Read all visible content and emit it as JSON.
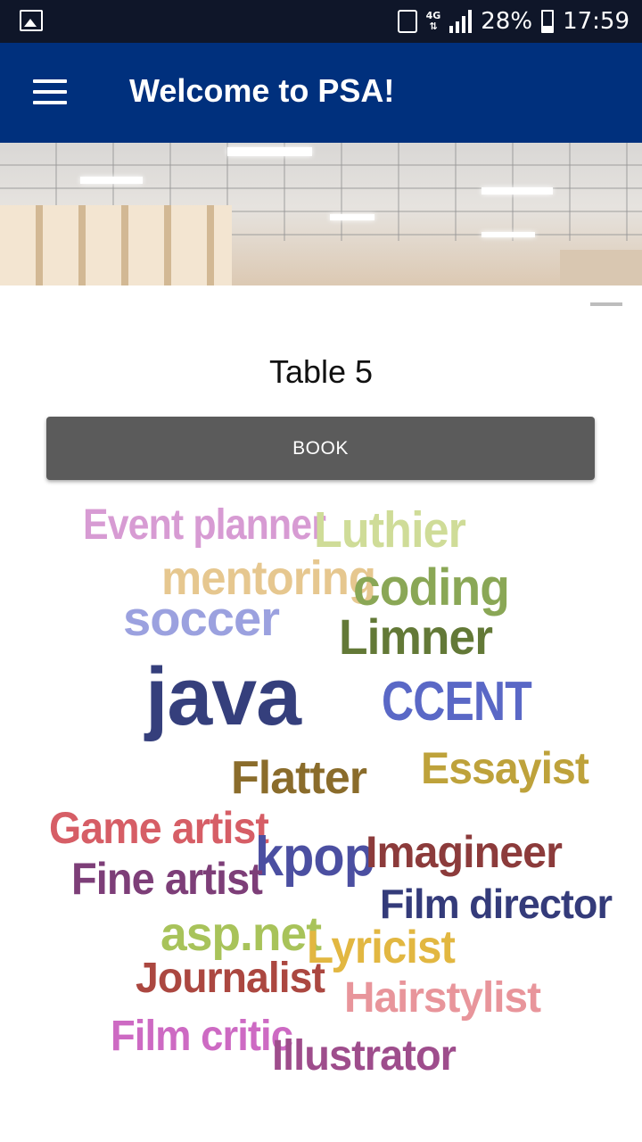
{
  "status_bar": {
    "battery": "28%",
    "time": "17:59",
    "network": "4G",
    "icons": [
      "gallery-icon",
      "vibrate-icon",
      "network-4g-icon",
      "signal-icon",
      "battery-icon"
    ]
  },
  "app_bar": {
    "title": "Welcome to PSA!",
    "menu_icon": "hamburger-menu-icon",
    "background": "#00307d"
  },
  "table": {
    "label": "Table 5",
    "book_label": "BOOK"
  },
  "word_cloud": [
    {
      "text": "Event planner",
      "color": "#d79bd3"
    },
    {
      "text": "Luthier",
      "color": "#cfdc98"
    },
    {
      "text": "mentoring",
      "color": "#e6c78f"
    },
    {
      "text": "coding",
      "color": "#8aa756"
    },
    {
      "text": "soccer",
      "color": "#9ba1df"
    },
    {
      "text": "Limner",
      "color": "#637937"
    },
    {
      "text": "java",
      "color": "#353f7c"
    },
    {
      "text": "CCENT",
      "color": "#5a68c6"
    },
    {
      "text": "Flatter",
      "color": "#8a6c2b"
    },
    {
      "text": "Essayist",
      "color": "#bea23b"
    },
    {
      "text": "Game artist",
      "color": "#d65e66"
    },
    {
      "text": "kpop",
      "color": "#4b4fa1"
    },
    {
      "text": "Imagineer",
      "color": "#8c3b3b"
    },
    {
      "text": "Fine artist",
      "color": "#7d3e78"
    },
    {
      "text": "Film director",
      "color": "#343b7a"
    },
    {
      "text": "asp.net",
      "color": "#a8c35a"
    },
    {
      "text": "Lyricist",
      "color": "#e2b741"
    },
    {
      "text": "Journalist",
      "color": "#ab4740"
    },
    {
      "text": "Hairstylist",
      "color": "#e8959b"
    },
    {
      "text": "Film critic",
      "color": "#cd6ac3"
    },
    {
      "text": "Illustrator",
      "color": "#9e4d8c"
    }
  ]
}
